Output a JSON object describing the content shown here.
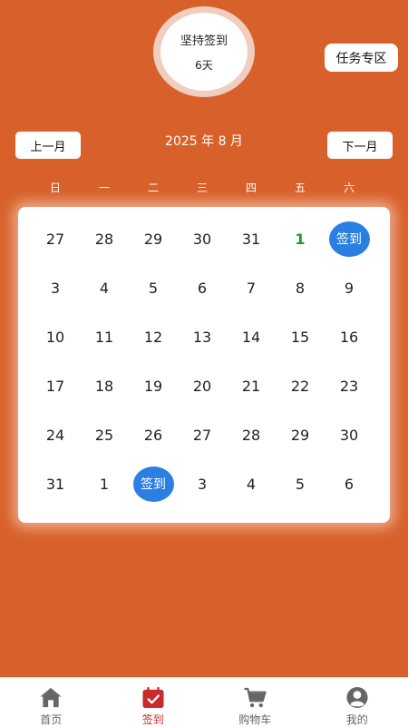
{
  "colors": {
    "background": "#d8612b",
    "signed_badge": "#2b7fe3",
    "today_text": "#1f9a2a",
    "tab_active": "#c92b2b"
  },
  "streak": {
    "label": "坚持签到",
    "days": "6天"
  },
  "task_button": "任务专区",
  "month_nav": {
    "prev": "上一月",
    "next": "下一月",
    "title": "2025 年 8 月"
  },
  "weekdays": [
    "日",
    "一",
    "二",
    "三",
    "四",
    "五",
    "六"
  ],
  "calendar": {
    "rows": [
      [
        "27",
        "28",
        "29",
        "30",
        "31",
        "1",
        "签到"
      ],
      [
        "3",
        "4",
        "5",
        "6",
        "7",
        "8",
        "9"
      ],
      [
        "10",
        "11",
        "12",
        "13",
        "14",
        "15",
        "16"
      ],
      [
        "17",
        "18",
        "19",
        "20",
        "21",
        "22",
        "23"
      ],
      [
        "24",
        "25",
        "26",
        "27",
        "28",
        "29",
        "30"
      ],
      [
        "31",
        "1",
        "签到",
        "3",
        "4",
        "5",
        "6"
      ]
    ],
    "today": "1",
    "signed_label": "签到"
  },
  "tabs": [
    {
      "label": "首页",
      "icon": "home-icon"
    },
    {
      "label": "签到",
      "icon": "calendar-check-icon",
      "active": true
    },
    {
      "label": "购物车",
      "icon": "cart-icon"
    },
    {
      "label": "我的",
      "icon": "user-icon"
    }
  ]
}
